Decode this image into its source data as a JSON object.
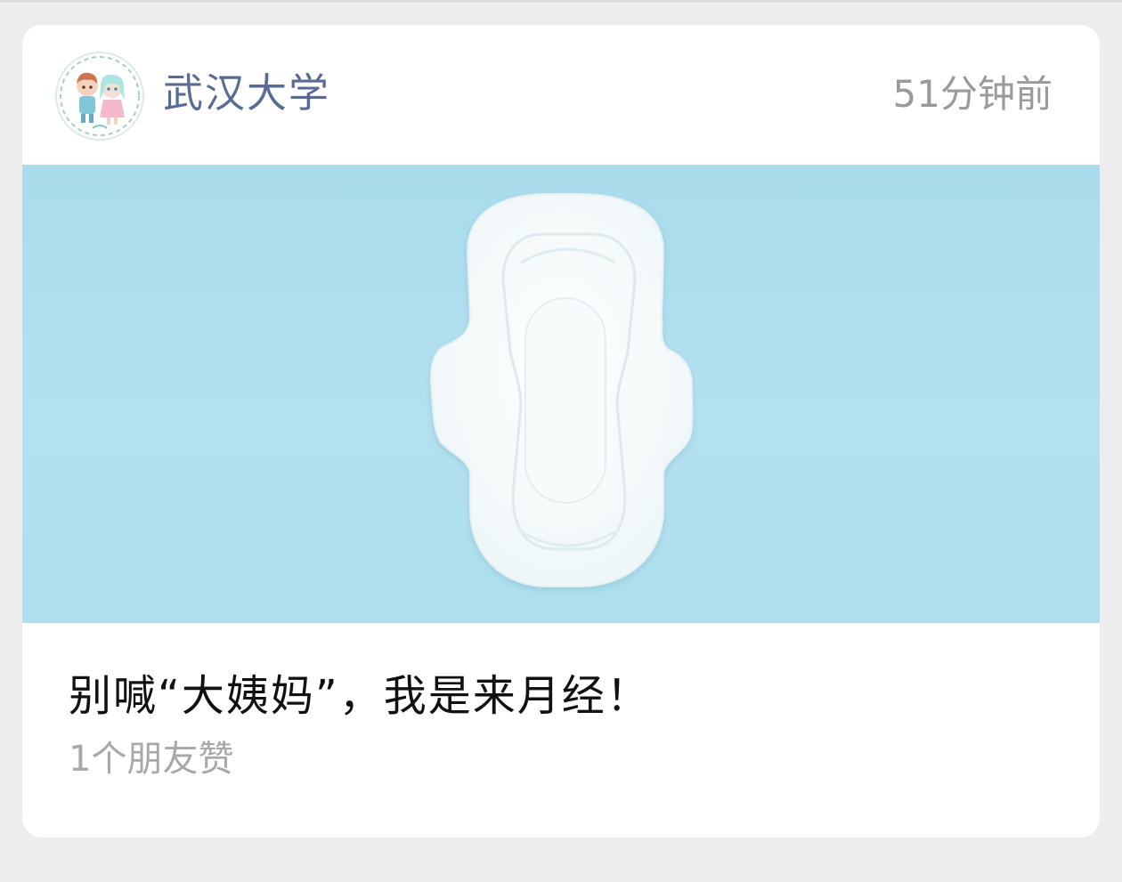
{
  "card": {
    "account_name": "武汉大学",
    "post_time": "51分钟前",
    "avatar_icon": "cartoon-couple-avatar-icon",
    "cover_image": "sanitary-pad-on-blue-background-image",
    "title": "别喊“大姨妈”，我是来月经！",
    "likes_text": "1个朋友赞"
  },
  "colors": {
    "page_background": "#ededed",
    "card_background": "#ffffff",
    "account_name": "#576b95",
    "post_time": "#9a9a9a",
    "title": "#111111",
    "likes": "#a8a8a8",
    "cover_background": "#aedfed"
  }
}
